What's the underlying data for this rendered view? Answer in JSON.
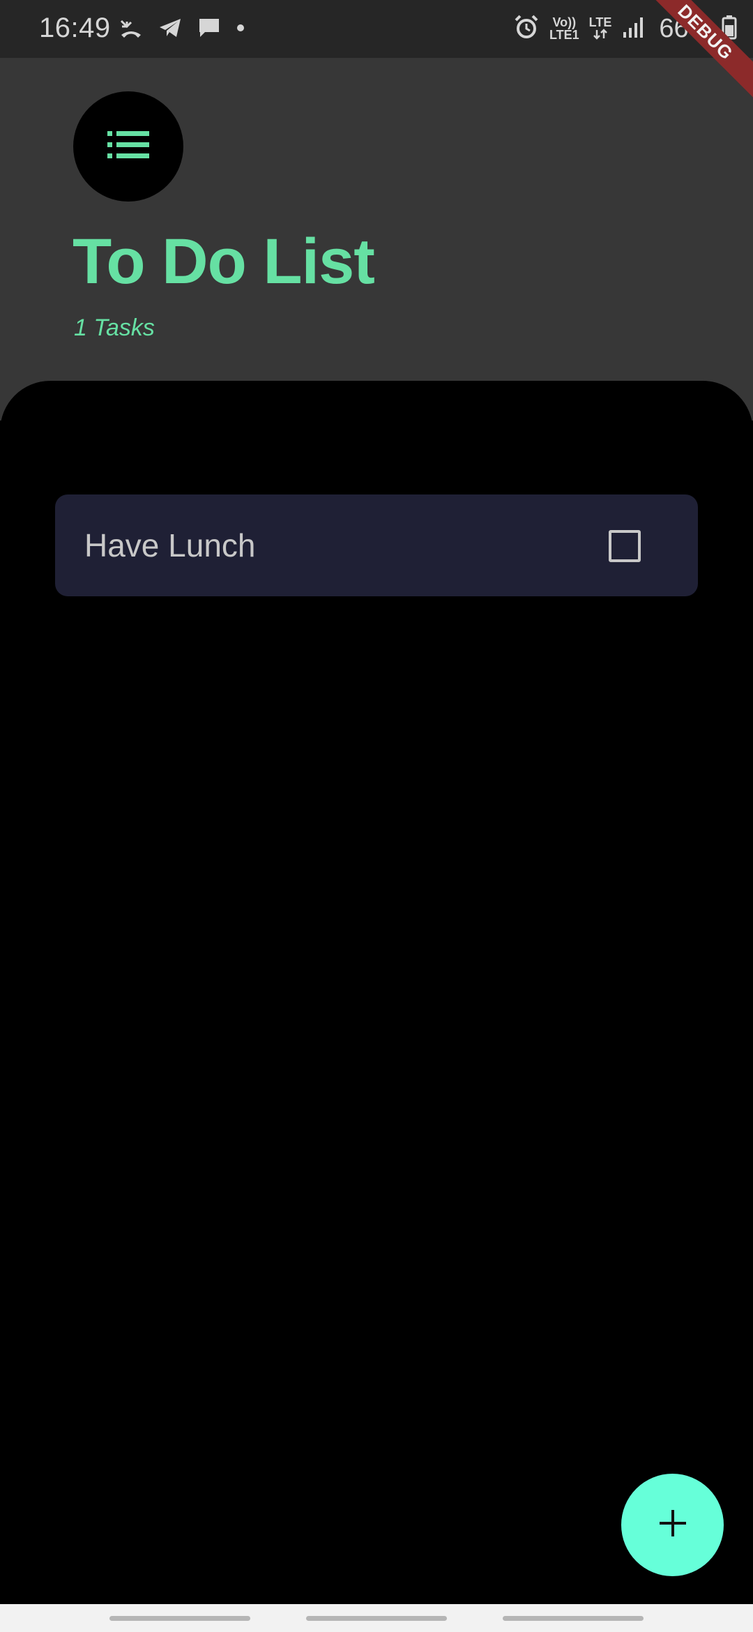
{
  "status_bar": {
    "time": "16:49",
    "left_icons": [
      "missed-call-icon",
      "telegram-icon",
      "message-icon",
      "dot-icon"
    ],
    "right_icons": [
      "alarm-icon",
      "volte-icon",
      "lte-icon",
      "signal-icon",
      "battery-icon"
    ],
    "volte_label_top": "Vo))",
    "volte_label_bottom": "LTE1",
    "lte_label": "LTE",
    "battery": "66%",
    "debug_badge": "DEBUG"
  },
  "header": {
    "menu_icon": "list-icon",
    "title": "To Do List",
    "task_count": "1 Tasks"
  },
  "tasks": [
    {
      "title": "Have Lunch",
      "done": false
    }
  ],
  "fab": {
    "icon": "plus-icon"
  },
  "colors": {
    "accent": "#66e0a3",
    "fab": "#66ffd9",
    "header_bg": "#373737",
    "card_bg": "#1f2035",
    "status_bar_bg": "#262626",
    "debug_ribbon": "#8c2a2a"
  }
}
